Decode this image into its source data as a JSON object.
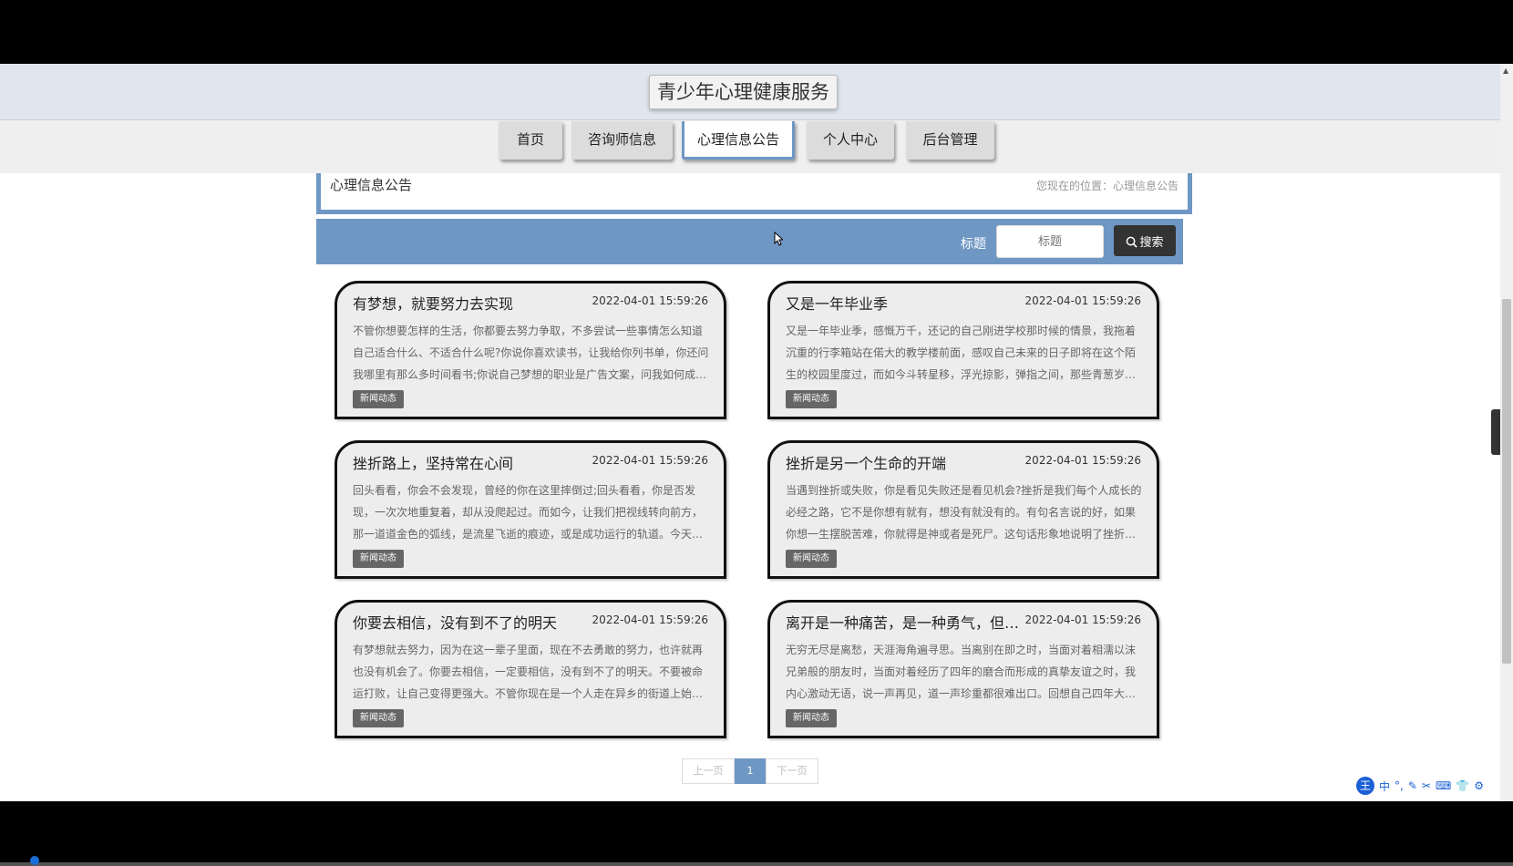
{
  "site": {
    "title": "青少年心理健康服务"
  },
  "nav": [
    {
      "label": "首页"
    },
    {
      "label": "咨询师信息"
    },
    {
      "label": "心理信息公告",
      "active": true
    },
    {
      "label": "个人中心"
    },
    {
      "label": "后台管理"
    }
  ],
  "breadcrumb": {
    "title": "心理信息公告",
    "position": "您现在的位置：心理信息公告"
  },
  "search": {
    "label": "标题",
    "placeholder": "标题",
    "button_label": "搜索"
  },
  "articles": [
    {
      "title": "有梦想，就要努力去实现",
      "date": "2022-04-01 15:59:26",
      "summary": "不管你想要怎样的生活，你都要去努力争取，不多尝试一些事情怎么知道自己适合什么、不适合什么呢?你说你喜欢读书，让我给你列书单，你还问我哪里有那么多时间看书;你说自己梦想的职业是广告文案，问我如何成…",
      "tag": "新闻动态"
    },
    {
      "title": "又是一年毕业季",
      "date": "2022-04-01 15:59:26",
      "summary": "又是一年毕业季，感慨万千，还记的自己刚进学校那时候的情景，我拖着沉重的行李箱站在偌大的教学楼前面，感叹自己未来的日子即将在这个陌生的校园里度过，而如今斗转星移，浮光掠影，弹指之间，那些青葱岁…",
      "tag": "新闻动态"
    },
    {
      "title": "挫折路上，坚持常在心间",
      "date": "2022-04-01 15:59:26",
      "summary": "回头看看，你会不会发现，曾经的你在这里摔倒过;回头看看，你是否发现，一次次地重复着，却从没爬起过。而如今，让我们把视线转向前方，那一道道金色的弧线，是流星飞逝的痕迹，或是成功运行的轨道。今天…",
      "tag": "新闻动态"
    },
    {
      "title": "挫折是另一个生命的开端",
      "date": "2022-04-01 15:59:26",
      "summary": "当遇到挫折或失败，你是看见失败还是看见机会?挫折是我们每个人成长的必经之路，它不是你想有就有，想没有就没有的。有句名言说的好，如果你想一生摆脱苦难，你就得是神或者是死尸。这句话形象地说明了挫折…",
      "tag": "新闻动态"
    },
    {
      "title": "你要去相信，没有到不了的明天",
      "date": "2022-04-01 15:59:26",
      "summary": "有梦想就去努力，因为在这一辈子里面，现在不去勇敢的努力，也许就再也没有机会了。你要去相信，一定要相信，没有到不了的明天。不要被命运打败，让自己变得更强大。不管你现在是一个人走在异乡的街道上始…",
      "tag": "新闻动态"
    },
    {
      "title": "离开是一种痛苦，是一种勇气，但同样…",
      "date": "2022-04-01 15:59:26",
      "summary": "无穷无尽是离愁，天涯海角遍寻思。当离别在即之时，当面对着相濡以沫兄弟般的朋友时，当面对着经历了四年的磨合而形成的真挚友谊之时，我内心激动无语，说一声再见，道一声珍重都很难出口。回想自己四年大…",
      "tag": "新闻动态"
    }
  ],
  "pagination": {
    "prev": "上一页",
    "current": "1",
    "next": "下一页"
  },
  "ime": {
    "logo": "王",
    "mode": "中",
    "icons": [
      "°,",
      "✎",
      "✂",
      "⌨",
      "👕",
      "⚙"
    ]
  }
}
